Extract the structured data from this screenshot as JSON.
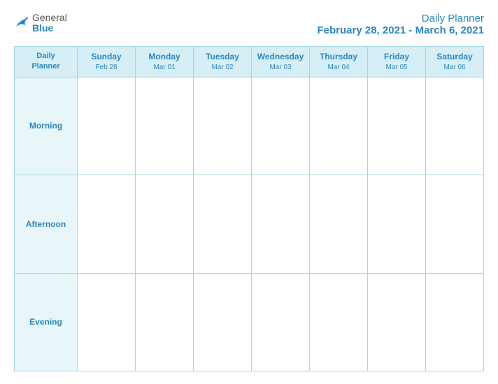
{
  "logo": {
    "general": "General",
    "blue": "Blue"
  },
  "header": {
    "title": "Daily Planner",
    "date_range": "February 28, 2021 - March 6, 2021"
  },
  "table": {
    "header_label": "Daily\nPlanner",
    "days": [
      {
        "name": "Sunday",
        "date": "Feb 28"
      },
      {
        "name": "Monday",
        "date": "Mar 01"
      },
      {
        "name": "Tuesday",
        "date": "Mar 02"
      },
      {
        "name": "Wednesday",
        "date": "Mar 03"
      },
      {
        "name": "Thursday",
        "date": "Mar 04"
      },
      {
        "name": "Friday",
        "date": "Mar 05"
      },
      {
        "name": "Saturday",
        "date": "Mar 06"
      }
    ],
    "rows": [
      {
        "label": "Morning"
      },
      {
        "label": "Afternoon"
      },
      {
        "label": "Evening"
      }
    ]
  }
}
